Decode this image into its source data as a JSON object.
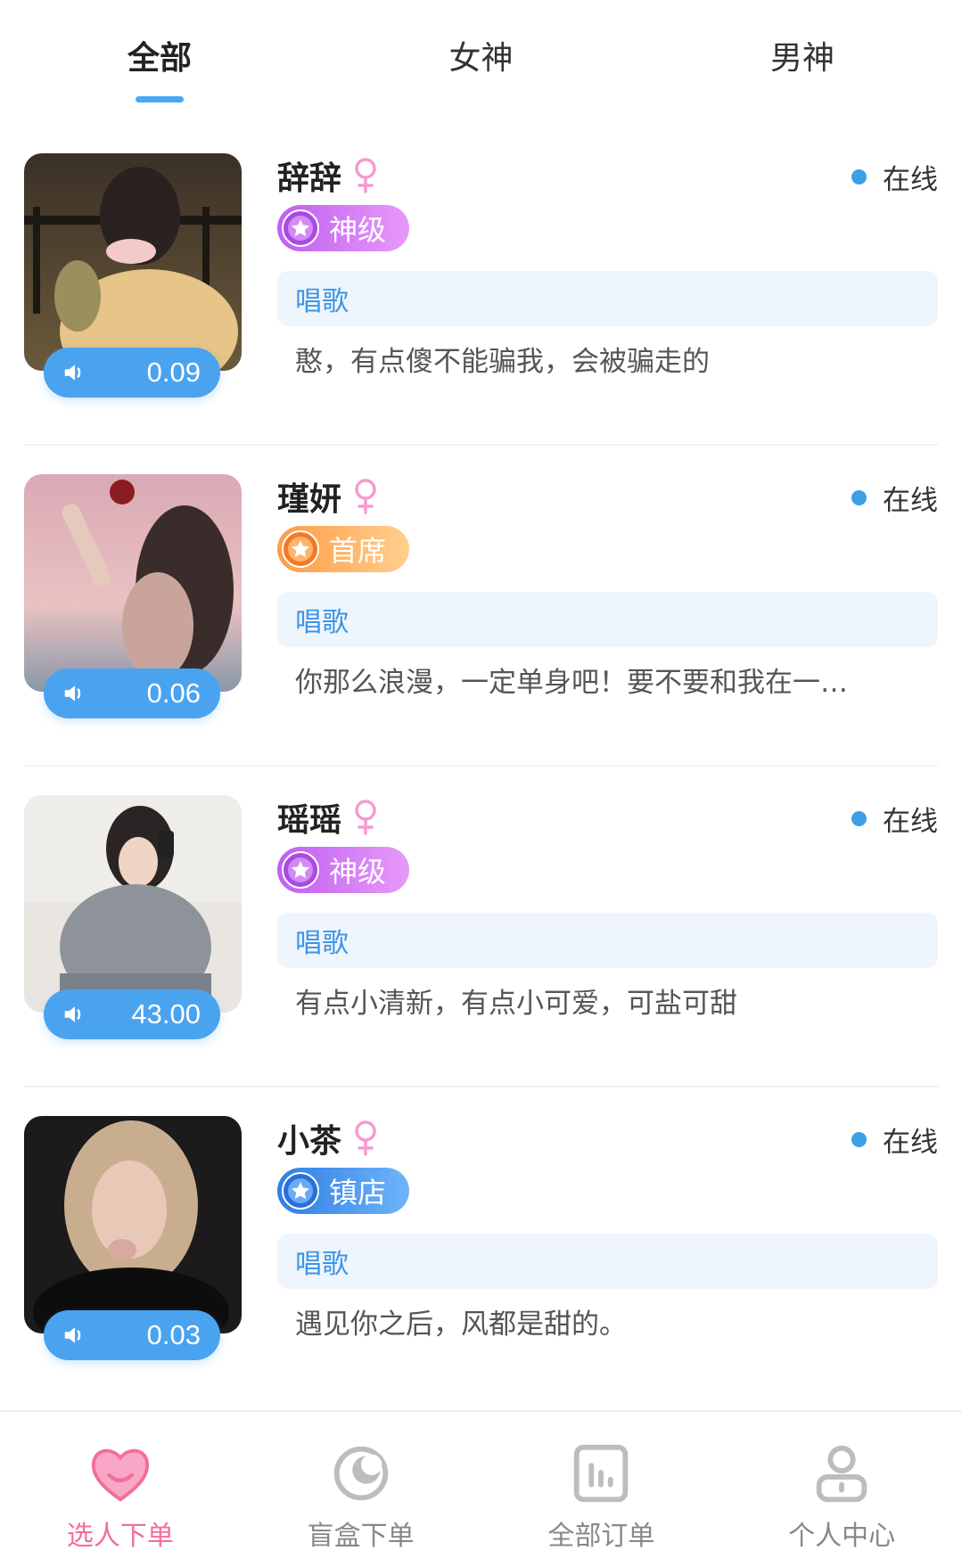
{
  "tabs": [
    {
      "label": "全部",
      "active": true
    },
    {
      "label": "女神",
      "active": false
    },
    {
      "label": "男神",
      "active": false
    }
  ],
  "colors": {
    "accent_blue": "#4aa3ee",
    "online_dot": "#3d9fe6",
    "female_pink": "#f59bd0",
    "nav_active": "#f36e9a"
  },
  "players": [
    {
      "name": "辞辞",
      "gender_icon": "female-icon",
      "status": "在线",
      "level": "神级",
      "level_color": "purple",
      "voice_duration": "0.09",
      "skill": "唱歌",
      "bio": "憨，有点傻不能骗我，会被骗走的"
    },
    {
      "name": "瑾妍",
      "gender_icon": "female-icon",
      "status": "在线",
      "level": "首席",
      "level_color": "orange",
      "voice_duration": "0.06",
      "skill": "唱歌",
      "bio": "你那么浪漫，一定单身吧！要不要和我在一…"
    },
    {
      "name": "瑶瑶",
      "gender_icon": "female-icon",
      "status": "在线",
      "level": "神级",
      "level_color": "purple",
      "voice_duration": "43.00",
      "skill": "唱歌",
      "bio": "有点小清新，有点小可爱，可盐可甜"
    },
    {
      "name": "小茶",
      "gender_icon": "female-icon",
      "status": "在线",
      "level": "镇店",
      "level_color": "blue",
      "voice_duration": "0.03",
      "skill": "唱歌",
      "bio": "遇见你之后，风都是甜的。"
    }
  ],
  "bottom_nav": [
    {
      "label": "选人下单",
      "icon": "heart-smile-icon",
      "active": true
    },
    {
      "label": "盲盒下单",
      "icon": "moon-icon",
      "active": false
    },
    {
      "label": "全部订单",
      "icon": "chart-icon",
      "active": false
    },
    {
      "label": "个人中心",
      "icon": "person-icon",
      "active": false
    }
  ]
}
